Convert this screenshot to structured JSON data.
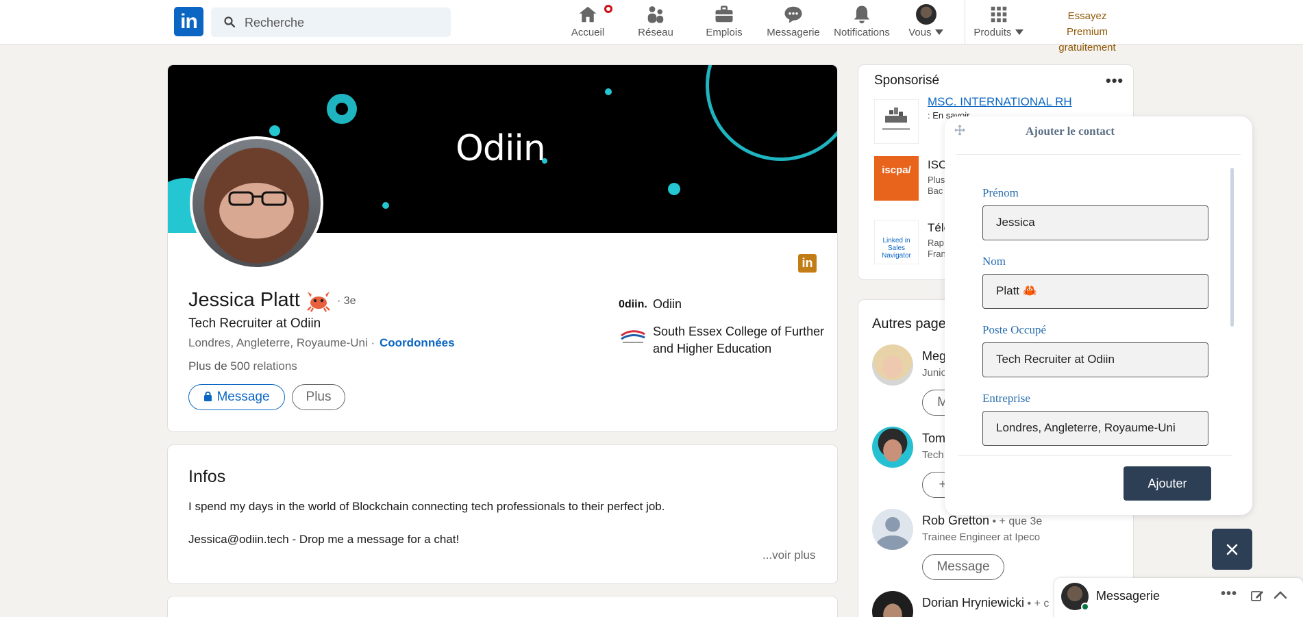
{
  "nav": {
    "logo_text": "in",
    "search_placeholder": "Recherche",
    "items": [
      {
        "label": "Accueil",
        "icon": "home-icon"
      },
      {
        "label": "Réseau",
        "icon": "network-icon"
      },
      {
        "label": "Emplois",
        "icon": "briefcase-icon"
      },
      {
        "label": "Messagerie",
        "icon": "messaging-icon"
      },
      {
        "label": "Notifications",
        "icon": "bell-icon"
      },
      {
        "label": "Vous",
        "icon": "avatar"
      },
      {
        "label": "Produits",
        "icon": "grid-icon"
      }
    ],
    "premium_line1": "Essayez Premium",
    "premium_line2": "gratuitement"
  },
  "profile": {
    "banner_brand": "Odiin",
    "name": "Jessica Platt",
    "degree": "· 3e",
    "headline": "Tech Recruiter at Odiin",
    "location": "Londres, Angleterre, Royaume-Uni ·",
    "contact_link": "Coordonnées",
    "relations_prefix": "Plus de 500",
    "relations_suffix": " relations",
    "message_button": "Message",
    "more_button": "Plus",
    "company_logo_text": "0diin.",
    "company": "Odiin",
    "school": "South Essex College of Further and Higher Education"
  },
  "infos": {
    "title": "Infos",
    "line1": "I spend my days in the world of Blockchain connecting tech professionals to their perfect job.",
    "line2": "Jessica@odiin.tech - Drop me a message for a chat!",
    "see_more": "...voir plus"
  },
  "ads": {
    "title": "Sponsorisé",
    "more": "•••",
    "items": [
      {
        "title": "MSC. INTERNATIONAL RH",
        "sub": ": En savoir..."
      },
      {
        "title": "ISCI",
        "sub1": "Plus",
        "sub2": "Bac",
        "logo_text": "iscpa/"
      },
      {
        "title": "Télé",
        "sub1": "Rap",
        "sub2": "Fran",
        "logo_text": "Linked in Sales Navigator"
      }
    ]
  },
  "others": {
    "title": "Autres page",
    "people": [
      {
        "name": "Meg",
        "sub": "Junic",
        "button": "M"
      },
      {
        "name": "Tom",
        "sub": "Tech",
        "button": "+"
      },
      {
        "name": "Rob Gretton",
        "degree": " • + que 3e",
        "sub": "Trainee Engineer at Ipeco",
        "button": "Message"
      },
      {
        "name": "Dorian Hryniewicki",
        "degree": " • + c",
        "sub": ""
      }
    ]
  },
  "modal": {
    "title": "Ajouter le contact",
    "fields": [
      {
        "label": "Prénom",
        "value": "Jessica"
      },
      {
        "label": "Nom",
        "value": "Platt 🦀"
      },
      {
        "label": "Poste Occupé",
        "value": "Tech Recruiter at Odiin"
      },
      {
        "label": "Entreprise",
        "value": "Londres, Angleterre, Royaume-Uni"
      }
    ],
    "submit": "Ajouter"
  },
  "dock": {
    "label": "Messagerie",
    "more": "•••"
  },
  "colors": {
    "linkedin_blue": "#0a66c2",
    "premium_gold": "#915907",
    "modal_button": "#2d3f55",
    "banner_accent": "#23c6d1"
  }
}
